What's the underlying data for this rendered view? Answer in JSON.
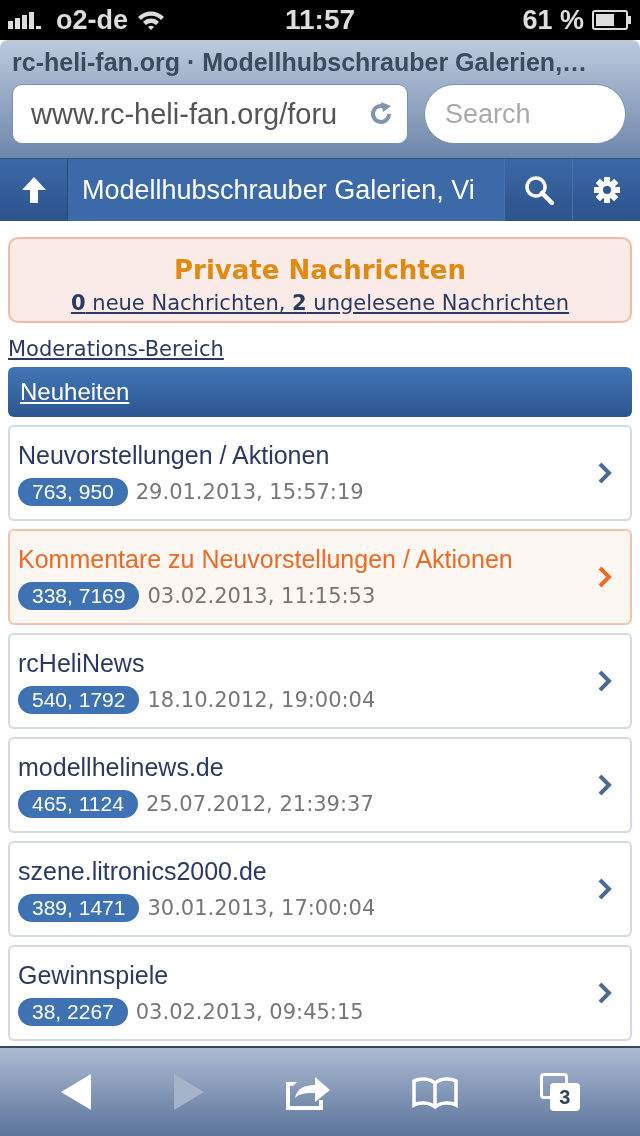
{
  "status_bar": {
    "carrier": "o2-de",
    "time": "11:57",
    "battery": "61 %"
  },
  "browser": {
    "title": "rc-heli-fan.org · Modellhubschrauber Galerien,…",
    "url": "www.rc-heli-fan.org/foru",
    "search": {
      "placeholder": "Search"
    }
  },
  "header": {
    "title": "Modellhubschrauber Galerien, Vi"
  },
  "private_messages": {
    "title": "Private Nachrichten",
    "summary": "**0** neue Nachrichten, **2** ungelesene Nachrichten"
  },
  "moderation_link": "Moderations-Bereich",
  "section": {
    "title": "Neuheiten"
  },
  "forums": [
    {
      "name": "Neuvorstellungen / Aktionen",
      "counts": "763, 950",
      "date": "29.01.2013, 15:57:19",
      "selected": false
    },
    {
      "name": "Kommentare zu Neuvorstellungen / Aktionen",
      "counts": "338, 7169",
      "date": "03.02.2013, 11:15:53",
      "selected": true
    },
    {
      "name": "rcHeliNews",
      "counts": "540, 1792",
      "date": "18.10.2012, 19:00:04",
      "selected": false
    },
    {
      "name": "modellhelinews.de",
      "counts": "465, 1124",
      "date": "25.07.2012, 21:39:37",
      "selected": false
    },
    {
      "name": "szene.litronics2000.de",
      "counts": "389, 1471",
      "date": "30.01.2013, 17:00:04",
      "selected": false
    },
    {
      "name": "Gewinnspiele",
      "counts": "38, 2267",
      "date": "03.02.2013, 09:45:15",
      "selected": false
    }
  ],
  "toolbar": [
    {
      "kind": "back",
      "disabled": false
    },
    {
      "kind": "forward",
      "disabled": true
    },
    {
      "kind": "share",
      "disabled": false
    },
    {
      "kind": "bookmarks",
      "disabled": false
    },
    {
      "kind": "tabs",
      "disabled": false,
      "count": "3"
    }
  ]
}
